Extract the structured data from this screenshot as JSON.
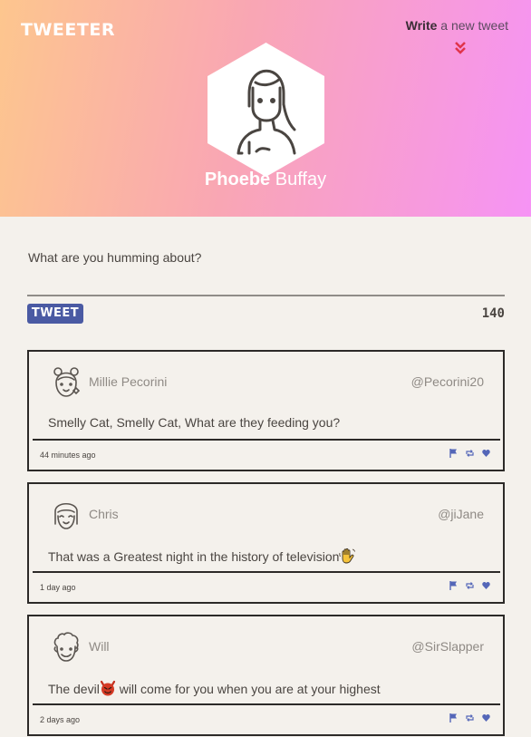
{
  "header": {
    "brand": "TWEETER",
    "write_strong": "Write",
    "write_rest": " a new tweet",
    "profile_first": "Phoebe",
    "profile_last": " Buffay"
  },
  "compose": {
    "placeholder": "What are you humming about?",
    "button_label": "TWEET",
    "counter": "140"
  },
  "colors": {
    "accent": "#4a5aa3",
    "chevron": "#e0344a",
    "icon": "#5466b8"
  },
  "tweets": [
    {
      "name": "Millie Pecorini",
      "handle": "@Pecorini20",
      "text": "Smelly Cat, Smelly Cat, What are they feeding you?",
      "emoji": "",
      "text_after": "",
      "time": "44 minutes ago",
      "avatar": "girl-buns-avatar"
    },
    {
      "name": "Chris",
      "handle": "@jiJane",
      "text": "That was a Greatest night in the history of television",
      "emoji": "waving-hand",
      "text_after": "",
      "time": "1 day ago",
      "avatar": "girl-bangs-avatar"
    },
    {
      "name": "Will",
      "handle": "@SirSlapper",
      "text": "The devil",
      "emoji": "devil",
      "text_after": " will come for you when you are at your highest",
      "time": "2 days ago",
      "avatar": "curly-man-avatar"
    }
  ]
}
